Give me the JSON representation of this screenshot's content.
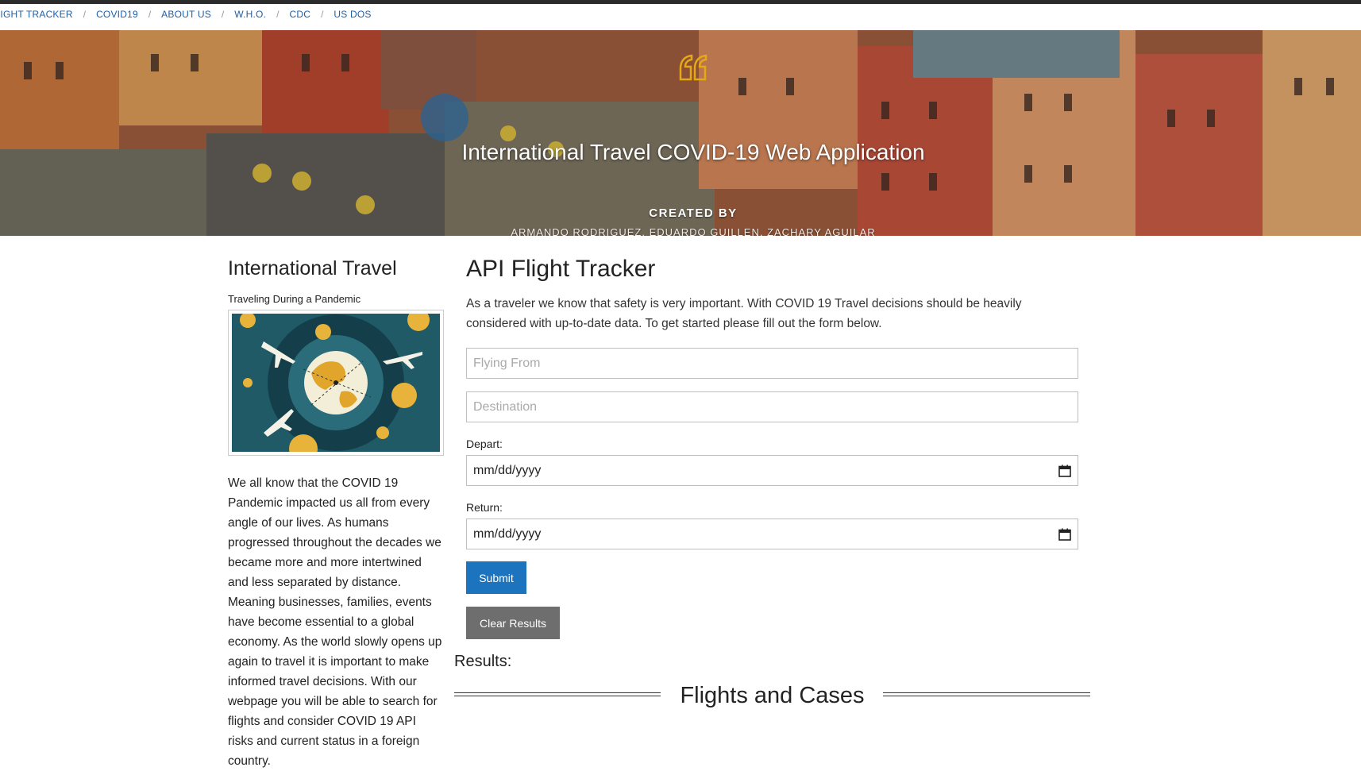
{
  "nav": {
    "crumbs": [
      "FLIGHT TRACKER",
      "COVID19",
      "ABOUT US",
      "W.H.O.",
      "CDC",
      "US DOS"
    ],
    "separator": "/"
  },
  "hero": {
    "title": "International Travel COVID-19 Web Application",
    "created_by": "CREATED BY",
    "authors": "ARMANDO RODRIGUEZ, EDUARDO GUILLEN, ZACHARY AGUILAR",
    "quote_icon": "quote-icon",
    "accent_color": "#e6a817"
  },
  "sidebar": {
    "heading": "International Travel",
    "subheading": "Traveling During a Pandemic",
    "image_icon": "globe-planes-virus-illustration",
    "body": "We all know that the COVID 19 Pandemic impacted us all from every angle of our lives. As humans progressed throughout the decades we became more and more intertwined and less separated by distance. Meaning businesses, families, events have become essential to a global economy. As the world slowly opens up again to travel it is important to make informed travel decisions. With our webpage you will be able to search for flights and consider COVID 19 API risks and current status in a foreign country."
  },
  "main": {
    "title": "API Flight Tracker",
    "intro": "As a traveler we know that safety is very important. With COVID 19 Travel decisions should be heavily considered with up-to-date data. To get started please fill out the form below.",
    "form": {
      "from_placeholder": "Flying From",
      "destination_placeholder": "Destination",
      "depart_label": "Depart:",
      "depart_value": "mm/dd/yyyy",
      "return_label": "Return:",
      "return_value": "mm/dd/yyyy",
      "submit_label": "Submit",
      "clear_label": "Clear Results"
    },
    "results_label": "Results:",
    "section_title": "Flights and Cases"
  },
  "colors": {
    "primary_button": "#1c74bf",
    "secondary_button": "#6e6e6e",
    "link": "#1e5fa8"
  }
}
